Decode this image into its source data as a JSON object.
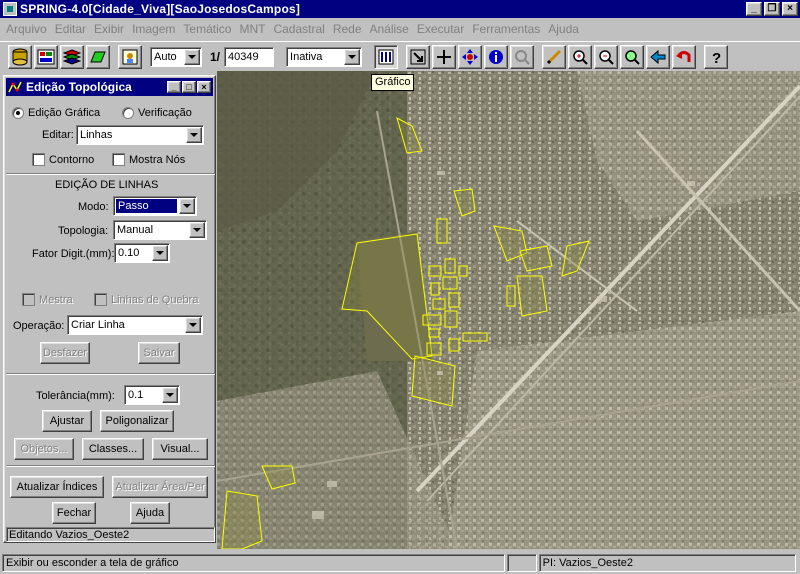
{
  "window": {
    "title": "SPRING-4.0[Cidade_Viva][SaoJosedosCampos]",
    "minimize": "_",
    "restore": "❐",
    "close": "×"
  },
  "menu": [
    "Arquivo",
    "Editar",
    "Exibir",
    "Imagem",
    "Temático",
    "MNT",
    "Cadastral",
    "Rede",
    "Análise",
    "Executar",
    "Ferramentas",
    "Ajuda"
  ],
  "toolbar": {
    "zoom_combo": "Auto",
    "scale_prefix": "1/",
    "scale_value": "40349",
    "mode_combo": "Inativa"
  },
  "tooltip": "Gráfico",
  "dialog": {
    "title": "Edição Topológica",
    "radio_grafica": "Edição Gráfica",
    "radio_verificacao": "Verificação",
    "editar_label": "Editar:",
    "editar_value": "Linhas",
    "contorno_label": "Contorno",
    "mostra_nos_label": "Mostra Nós",
    "section_heading": "EDIÇÃO DE LINHAS",
    "modo_label": "Modo:",
    "modo_value": "Passo",
    "topologia_label": "Topologia:",
    "topologia_value": "Manual",
    "fator_label": "Fator Digit.(mm):",
    "fator_value": "0.10",
    "mestra_label": "Mestra",
    "linhas_quebra_label": "Linhas de Quebra",
    "operacao_label": "Operação:",
    "operacao_value": "Criar Linha",
    "desfazer": "Desfazer",
    "salvar": "Salvar",
    "tolerancia_label": "Tolerância(mm):",
    "tolerancia_value": "0.1",
    "ajustar": "Ajustar",
    "poligonalizar": "Poligonalizar",
    "objetos": "Objetos...",
    "classes": "Classes...",
    "visual": "Visual...",
    "atualizar_indices": "Atualizar Índices",
    "atualizar_area": "Atualizar Área/Per",
    "fechar": "Fechar",
    "ajuda": "Ajuda",
    "status": "Editando Vazios_Oeste2"
  },
  "statusbar": {
    "message": "Exibir ou esconder a tela de gráfico",
    "pi": "PI: Vazios_Oeste2"
  },
  "colors": {
    "titlebar": "#000080",
    "face": "#c0c0c0",
    "polygon": "#ffff00"
  }
}
